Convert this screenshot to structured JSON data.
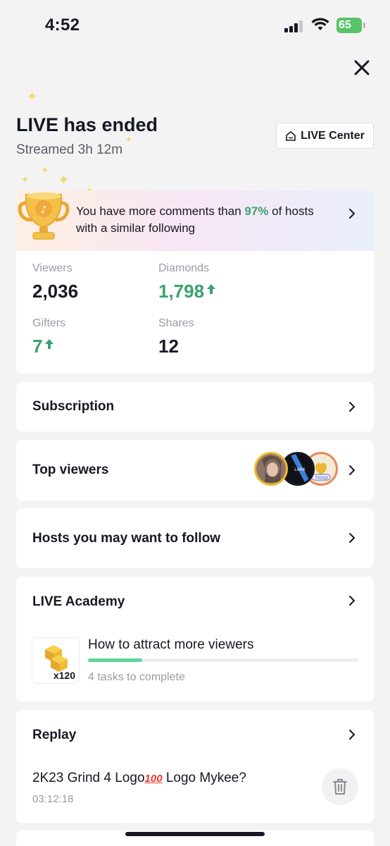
{
  "status_bar": {
    "time": "4:52",
    "battery": "65"
  },
  "header": {
    "title": "LIVE has ended",
    "subtitle": "Streamed 3h 12m",
    "live_center_label": "LIVE Center"
  },
  "banner": {
    "text_before": "You have more comments than ",
    "percent": "97%",
    "text_after": " of hosts with a similar following"
  },
  "stats": [
    {
      "label": "Viewers",
      "value": "2,036",
      "trend": "none"
    },
    {
      "label": "Diamonds",
      "value": "1,798",
      "trend": "up"
    },
    {
      "label": "Gifters",
      "value": "7",
      "trend": "up"
    },
    {
      "label": "Shares",
      "value": "12",
      "trend": "none"
    }
  ],
  "sections": {
    "subscription": "Subscription",
    "top_viewers": "Top viewers",
    "hosts_follow": "Hosts you may want to follow",
    "academy": "LIVE Academy",
    "replay": "Replay"
  },
  "top_viewer_avatars": [
    {
      "ring_color": "#f0b92b",
      "fill": "#c79a86"
    },
    {
      "ring_color": "#161823",
      "fill": "#2a2d3a",
      "text": "LARK"
    },
    {
      "ring_color": "#e58a5b",
      "fill": "#f4ead9",
      "text": "Hoop"
    }
  ],
  "academy": {
    "course_title": "How to attract more viewers",
    "progress_percent": 20,
    "course_subtitle": "4 tasks to complete",
    "reward_count": "x120"
  },
  "replay": {
    "title_before": "2K23 Grind 4 Logo",
    "title_emoji": "100",
    "title_after": " Logo Mykee?",
    "duration": "03:12:18"
  },
  "colors": {
    "accent_green": "#3aa36c",
    "progress_green": "#5ed49a",
    "background": "#f3f3f4"
  }
}
